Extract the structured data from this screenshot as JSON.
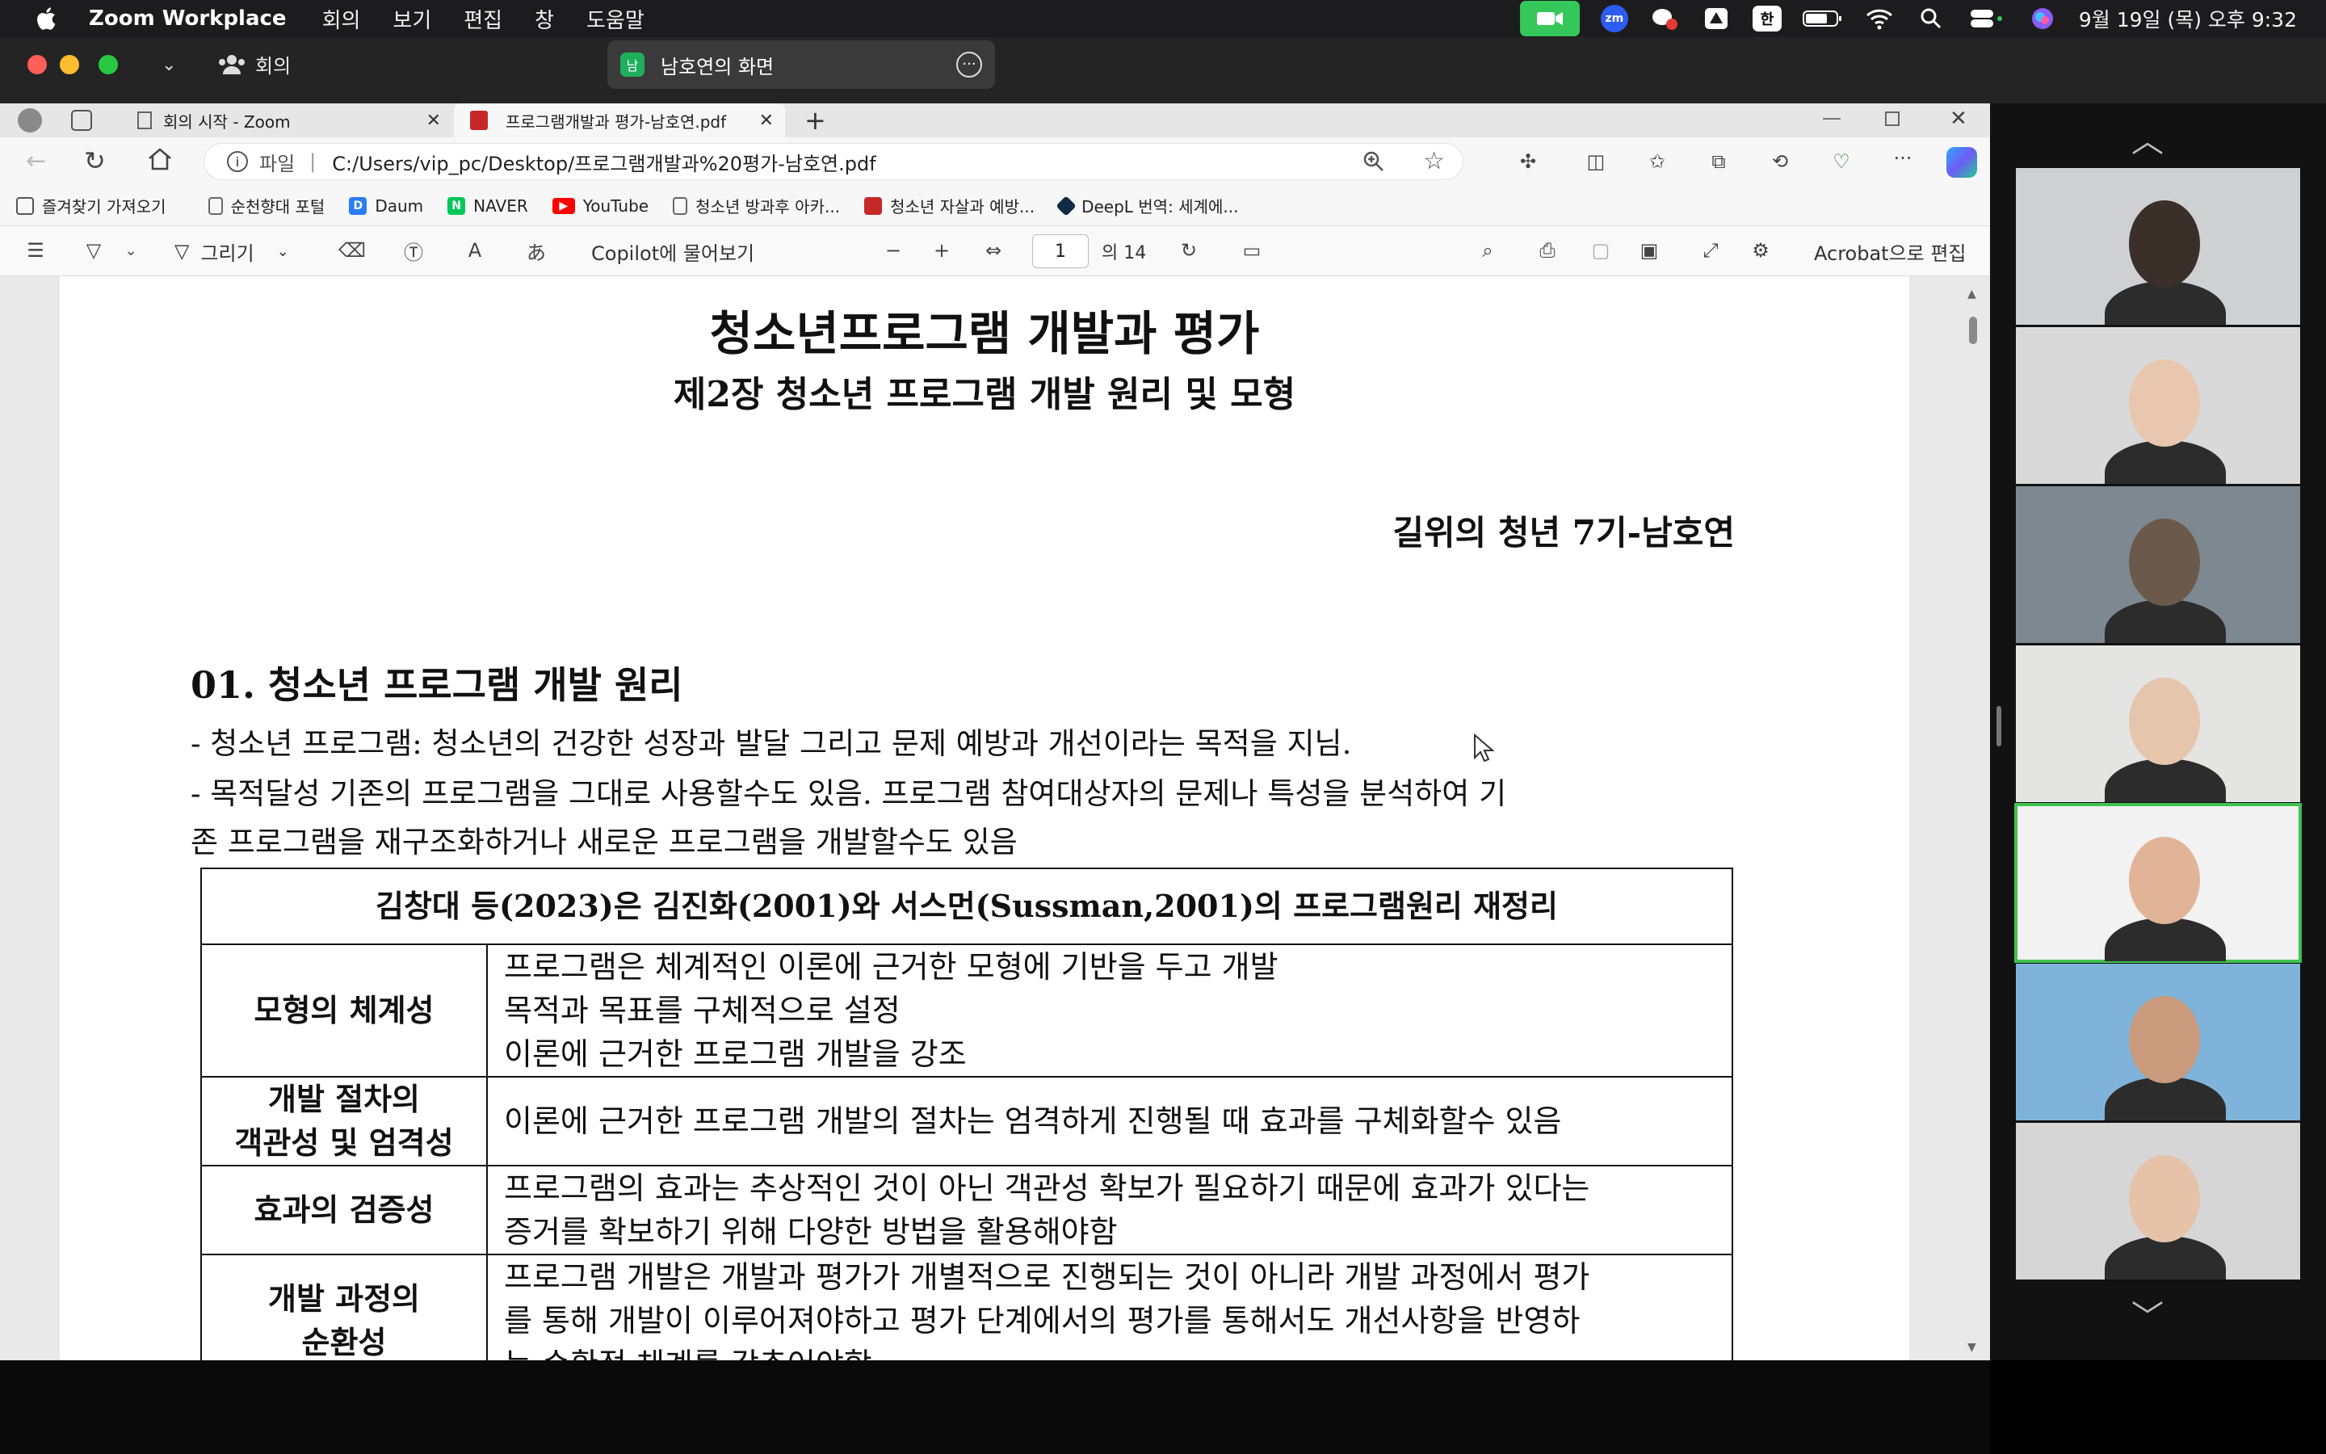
{
  "menubar": {
    "app_name": "Zoom Workplace",
    "menus": [
      "회의",
      "보기",
      "편집",
      "창",
      "도움말"
    ],
    "ime": "한",
    "clock": "9월 19일 (목) 오후 9:32"
  },
  "zoom_header": {
    "meeting_label": "회의",
    "share_title": "남호연의 화면",
    "share_badge": "남"
  },
  "browser": {
    "tabs": [
      {
        "label": "회의 시작 - Zoom"
      },
      {
        "label": "프로그램개발과 평가-남호연.pdf"
      }
    ],
    "address_prefix": "파일",
    "url": "C:/Users/vip_pc/Desktop/프로그램개발과%20평가-남호연.pdf",
    "favorites": [
      {
        "label": "즐겨찾기 가져오기",
        "icon": "folder-icon",
        "color": "#555555"
      },
      {
        "label": "순천향대 포털",
        "icon": "page-icon",
        "color": "#666666"
      },
      {
        "label": "Daum",
        "icon": "daum-icon",
        "color": "#2a7df6"
      },
      {
        "label": "NAVER",
        "icon": "naver-icon",
        "color": "#03c75a"
      },
      {
        "label": "YouTube",
        "icon": "youtube-icon",
        "color": "#ff0000"
      },
      {
        "label": "청소년 방과후 아카...",
        "icon": "page-icon",
        "color": "#666666"
      },
      {
        "label": "청소년 자살과 예방...",
        "icon": "pdf-icon",
        "color": "#c62828"
      },
      {
        "label": "DeepL 번역: 세계에...",
        "icon": "deepl-icon",
        "color": "#0f2b46"
      }
    ]
  },
  "pdf_toolbar": {
    "draw_label": "그리기",
    "copilot_label": "Copilot에 물어보기",
    "page_current": "1",
    "page_total": "의 14",
    "acrobat_label": "Acrobat으로 편집"
  },
  "document": {
    "title": "청소년프로그램 개발과 평가",
    "subtitle": "제2장 청소년 프로그램 개발 원리 및 모형",
    "author": "길위의 청년 7기-남호연",
    "section_heading": "01. 청소년 프로그램 개발 원리",
    "bullet1": "- 청소년 프로그램: 청소년의 건강한 성장과 발달 그리고 문제 예방과 개선이라는 목적을 지님.",
    "bullet2_line1": "- 목적달성 기존의 프로그램을 그대로 사용할수도 있음. 프로그램 참여대상자의 문제나 특성을 분석하여 기",
    "bullet2_line2": "존 프로그램을 재구조화하거나 새로운 프로그램을 개발할수도 있음",
    "table": {
      "caption": "김창대 등(2023)은 김진화(2001)와 서스먼(Sussman,2001)의 프로그램원리 재정리",
      "rows": [
        {
          "header": "모형의 체계성",
          "lines": [
            "프로그램은 체계적인 이론에 근거한 모형에 기반을 두고 개발",
            "목적과 목표를 구체적으로 설정",
            "이론에 근거한 프로그램 개발을 강조"
          ]
        },
        {
          "header": "개발 절차의 객관성 및 엄격성",
          "header_lines": [
            "개발 절차의",
            "객관성 및 엄격성"
          ],
          "lines": [
            "이론에 근거한 프로그램 개발의 절차는 엄격하게 진행될 때 효과를 구체화할수 있음"
          ]
        },
        {
          "header": "효과의 검증성",
          "lines": [
            "프로그램의 효과는 추상적인 것이 아닌 객관성 확보가 필요하기 때문에 효과가 있다는",
            "증거를 확보하기 위해 다양한 방법을 활용해야함"
          ]
        },
        {
          "header_lines": [
            "개발 과정의",
            "순환성"
          ],
          "lines": [
            "프로그램 개발은 개발과 평가가 개별적으로 진행되는 것이 아니라 개발 과정에서 평가",
            "를 통해 개발이 이루어져야하고 평가 단계에서의 평가를 통해서도 개선사항을 반영하",
            "는 순환적 체계를 갖추어야함"
          ]
        }
      ]
    }
  },
  "gallery": {
    "participants": [
      {
        "bg": "#cfd0d2",
        "skin": "#3b2f2a"
      },
      {
        "bg": "#d9d9d9",
        "skin": "#e9c6ae"
      },
      {
        "bg": "#7d8890",
        "skin": "#6b5a4c"
      },
      {
        "bg": "#e4e4e2",
        "skin": "#e6c5ad"
      },
      {
        "bg": "#f2f2f2",
        "skin": "#e2b497"
      },
      {
        "bg": "#7fb3d9",
        "skin": "#c99a7c"
      },
      {
        "bg": "#d6d6d6",
        "skin": "#e5c2a8"
      }
    ],
    "active_index": 4
  },
  "colors": {
    "zoom_green": "#1fae5c",
    "active_speaker": "#3fc34f"
  }
}
